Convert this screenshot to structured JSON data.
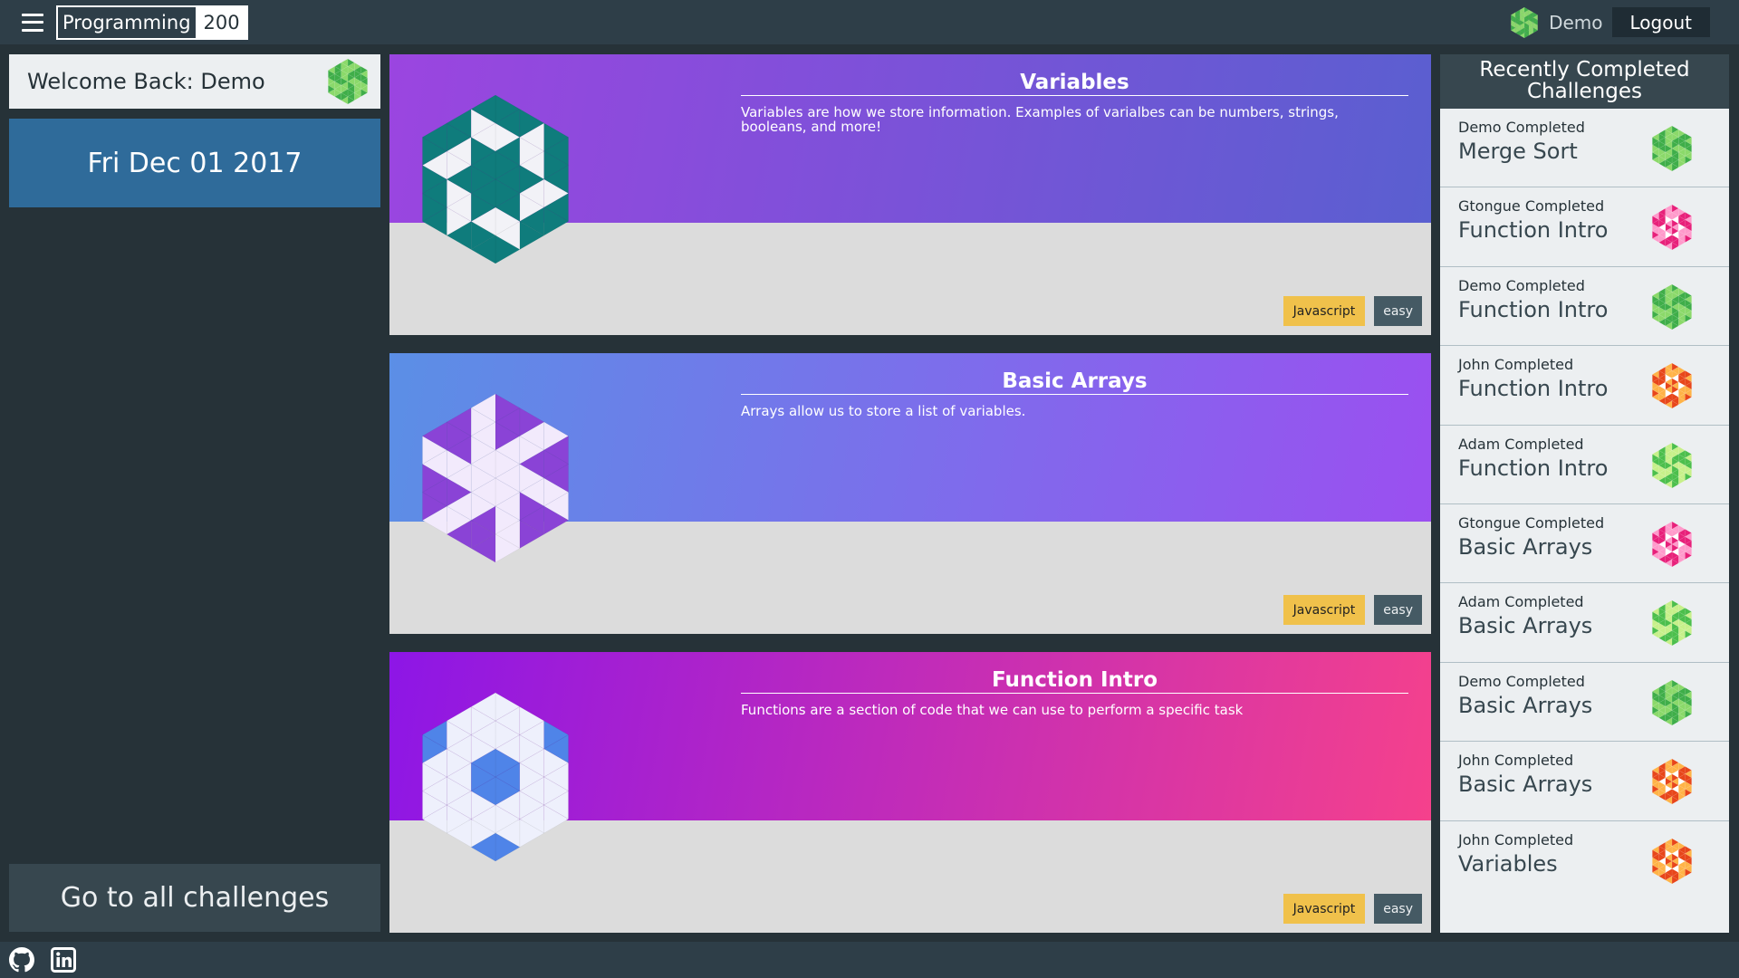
{
  "header": {
    "brand_name": "Programming",
    "brand_score": "200",
    "user_name": "Demo",
    "logout_label": "Logout"
  },
  "sidebar": {
    "welcome_text": "Welcome Back: Demo",
    "date_text": "Fri Dec 01 2017",
    "all_challenges_label": "Go to all challenges"
  },
  "challenges": [
    {
      "title": "Variables",
      "description": "Variables are how we store information. Examples of varialbes can be numbers, strings, booleans, and more!",
      "language": "Javascript",
      "difficulty": "easy",
      "gradient": [
        "#9b45e0",
        "#5a5fd0"
      ],
      "icon_colors": {
        "hex": "#0f7c7c",
        "shape": "#f2f2f7"
      }
    },
    {
      "title": "Basic Arrays",
      "description": "Arrays allow us to store a list of variables.",
      "language": "Javascript",
      "difficulty": "easy",
      "gradient": [
        "#5b8fe6",
        "#9b4ff0"
      ],
      "icon_colors": {
        "hex": "#f2eafc",
        "shape": "#8a43d6"
      }
    },
    {
      "title": "Function Intro",
      "description": "Functions are a section of code that we can use to perform a specific task",
      "language": "Javascript",
      "difficulty": "easy",
      "gradient": [
        "#8d16e6",
        "#f5418c"
      ],
      "icon_colors": {
        "hex": "#eef0fc",
        "shape": "#4f84e8"
      }
    }
  ],
  "recent": {
    "heading": "Recently Completed Challenges",
    "items": [
      {
        "user": "Demo Completed",
        "challenge": "Merge Sort",
        "avatar": "green"
      },
      {
        "user": "Gtongue Completed",
        "challenge": "Function Intro",
        "avatar": "pink"
      },
      {
        "user": "Demo Completed",
        "challenge": "Function Intro",
        "avatar": "green"
      },
      {
        "user": "John Completed",
        "challenge": "Function Intro",
        "avatar": "orange"
      },
      {
        "user": "Adam Completed",
        "challenge": "Function Intro",
        "avatar": "lime"
      },
      {
        "user": "Gtongue Completed",
        "challenge": "Basic Arrays",
        "avatar": "pink"
      },
      {
        "user": "Adam Completed",
        "challenge": "Basic Arrays",
        "avatar": "lime"
      },
      {
        "user": "Demo Completed",
        "challenge": "Basic Arrays",
        "avatar": "green"
      },
      {
        "user": "John Completed",
        "challenge": "Basic Arrays",
        "avatar": "orange"
      },
      {
        "user": "John Completed",
        "challenge": "Variables",
        "avatar": "orange"
      }
    ]
  },
  "avatar_palettes": {
    "green": [
      "#3fae49",
      "#8bd96a"
    ],
    "pink": [
      "#e8207a",
      "#ff9acb"
    ],
    "orange": [
      "#e8461a",
      "#ffb347"
    ],
    "lime": [
      "#4cbf4c",
      "#c7f08a"
    ]
  },
  "footer": {
    "icons": [
      "github-icon",
      "linkedin-icon"
    ]
  }
}
